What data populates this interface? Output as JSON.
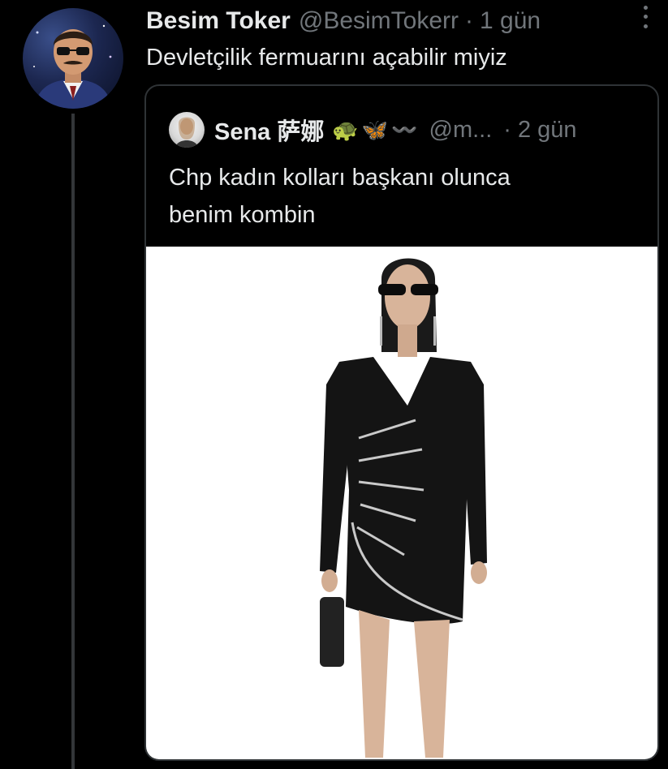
{
  "tweet": {
    "author_name": "Besim Toker",
    "author_handle": "@BesimTokerr",
    "separator": "·",
    "time": "1 gün",
    "text": "Devletçilik fermuarını açabilir miyiz",
    "avatar_icon": "profile-photo",
    "more_icon": "more-options-icon"
  },
  "quote": {
    "author_name": "Sena 萨娜",
    "author_emoji": "🐢🦋〰️",
    "author_handle": "@m...",
    "separator": "·",
    "time": "2 gün",
    "text_line1": "Chp kadın kolları başkanı olunca",
    "text_line2": "benim kombin",
    "media_description": "photo"
  },
  "colors": {
    "background": "#000000",
    "text_primary": "#e7e9ea",
    "text_secondary": "#71767b",
    "border": "#2f3336",
    "media_background": "#ffffff"
  }
}
